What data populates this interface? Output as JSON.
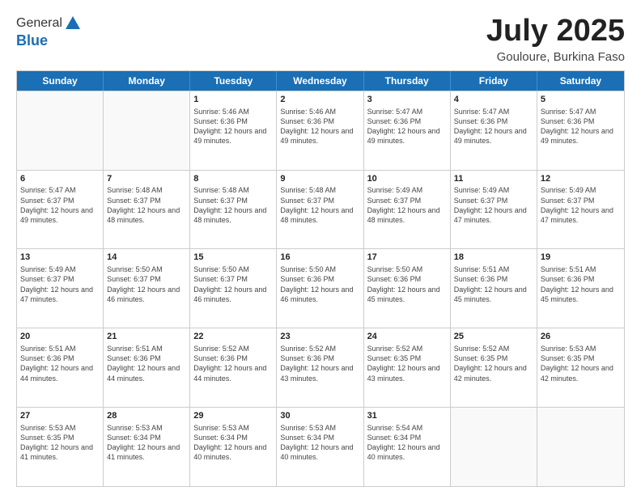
{
  "header": {
    "logo_line1": "General",
    "logo_line2": "Blue",
    "month": "July 2025",
    "location": "Gouloure, Burkina Faso"
  },
  "weekdays": [
    "Sunday",
    "Monday",
    "Tuesday",
    "Wednesday",
    "Thursday",
    "Friday",
    "Saturday"
  ],
  "weeks": [
    [
      {
        "day": "",
        "sunrise": "",
        "sunset": "",
        "daylight": ""
      },
      {
        "day": "",
        "sunrise": "",
        "sunset": "",
        "daylight": ""
      },
      {
        "day": "1",
        "sunrise": "Sunrise: 5:46 AM",
        "sunset": "Sunset: 6:36 PM",
        "daylight": "Daylight: 12 hours and 49 minutes."
      },
      {
        "day": "2",
        "sunrise": "Sunrise: 5:46 AM",
        "sunset": "Sunset: 6:36 PM",
        "daylight": "Daylight: 12 hours and 49 minutes."
      },
      {
        "day": "3",
        "sunrise": "Sunrise: 5:47 AM",
        "sunset": "Sunset: 6:36 PM",
        "daylight": "Daylight: 12 hours and 49 minutes."
      },
      {
        "day": "4",
        "sunrise": "Sunrise: 5:47 AM",
        "sunset": "Sunset: 6:36 PM",
        "daylight": "Daylight: 12 hours and 49 minutes."
      },
      {
        "day": "5",
        "sunrise": "Sunrise: 5:47 AM",
        "sunset": "Sunset: 6:36 PM",
        "daylight": "Daylight: 12 hours and 49 minutes."
      }
    ],
    [
      {
        "day": "6",
        "sunrise": "Sunrise: 5:47 AM",
        "sunset": "Sunset: 6:37 PM",
        "daylight": "Daylight: 12 hours and 49 minutes."
      },
      {
        "day": "7",
        "sunrise": "Sunrise: 5:48 AM",
        "sunset": "Sunset: 6:37 PM",
        "daylight": "Daylight: 12 hours and 48 minutes."
      },
      {
        "day": "8",
        "sunrise": "Sunrise: 5:48 AM",
        "sunset": "Sunset: 6:37 PM",
        "daylight": "Daylight: 12 hours and 48 minutes."
      },
      {
        "day": "9",
        "sunrise": "Sunrise: 5:48 AM",
        "sunset": "Sunset: 6:37 PM",
        "daylight": "Daylight: 12 hours and 48 minutes."
      },
      {
        "day": "10",
        "sunrise": "Sunrise: 5:49 AM",
        "sunset": "Sunset: 6:37 PM",
        "daylight": "Daylight: 12 hours and 48 minutes."
      },
      {
        "day": "11",
        "sunrise": "Sunrise: 5:49 AM",
        "sunset": "Sunset: 6:37 PM",
        "daylight": "Daylight: 12 hours and 47 minutes."
      },
      {
        "day": "12",
        "sunrise": "Sunrise: 5:49 AM",
        "sunset": "Sunset: 6:37 PM",
        "daylight": "Daylight: 12 hours and 47 minutes."
      }
    ],
    [
      {
        "day": "13",
        "sunrise": "Sunrise: 5:49 AM",
        "sunset": "Sunset: 6:37 PM",
        "daylight": "Daylight: 12 hours and 47 minutes."
      },
      {
        "day": "14",
        "sunrise": "Sunrise: 5:50 AM",
        "sunset": "Sunset: 6:37 PM",
        "daylight": "Daylight: 12 hours and 46 minutes."
      },
      {
        "day": "15",
        "sunrise": "Sunrise: 5:50 AM",
        "sunset": "Sunset: 6:37 PM",
        "daylight": "Daylight: 12 hours and 46 minutes."
      },
      {
        "day": "16",
        "sunrise": "Sunrise: 5:50 AM",
        "sunset": "Sunset: 6:36 PM",
        "daylight": "Daylight: 12 hours and 46 minutes."
      },
      {
        "day": "17",
        "sunrise": "Sunrise: 5:50 AM",
        "sunset": "Sunset: 6:36 PM",
        "daylight": "Daylight: 12 hours and 45 minutes."
      },
      {
        "day": "18",
        "sunrise": "Sunrise: 5:51 AM",
        "sunset": "Sunset: 6:36 PM",
        "daylight": "Daylight: 12 hours and 45 minutes."
      },
      {
        "day": "19",
        "sunrise": "Sunrise: 5:51 AM",
        "sunset": "Sunset: 6:36 PM",
        "daylight": "Daylight: 12 hours and 45 minutes."
      }
    ],
    [
      {
        "day": "20",
        "sunrise": "Sunrise: 5:51 AM",
        "sunset": "Sunset: 6:36 PM",
        "daylight": "Daylight: 12 hours and 44 minutes."
      },
      {
        "day": "21",
        "sunrise": "Sunrise: 5:51 AM",
        "sunset": "Sunset: 6:36 PM",
        "daylight": "Daylight: 12 hours and 44 minutes."
      },
      {
        "day": "22",
        "sunrise": "Sunrise: 5:52 AM",
        "sunset": "Sunset: 6:36 PM",
        "daylight": "Daylight: 12 hours and 44 minutes."
      },
      {
        "day": "23",
        "sunrise": "Sunrise: 5:52 AM",
        "sunset": "Sunset: 6:36 PM",
        "daylight": "Daylight: 12 hours and 43 minutes."
      },
      {
        "day": "24",
        "sunrise": "Sunrise: 5:52 AM",
        "sunset": "Sunset: 6:35 PM",
        "daylight": "Daylight: 12 hours and 43 minutes."
      },
      {
        "day": "25",
        "sunrise": "Sunrise: 5:52 AM",
        "sunset": "Sunset: 6:35 PM",
        "daylight": "Daylight: 12 hours and 42 minutes."
      },
      {
        "day": "26",
        "sunrise": "Sunrise: 5:53 AM",
        "sunset": "Sunset: 6:35 PM",
        "daylight": "Daylight: 12 hours and 42 minutes."
      }
    ],
    [
      {
        "day": "27",
        "sunrise": "Sunrise: 5:53 AM",
        "sunset": "Sunset: 6:35 PM",
        "daylight": "Daylight: 12 hours and 41 minutes."
      },
      {
        "day": "28",
        "sunrise": "Sunrise: 5:53 AM",
        "sunset": "Sunset: 6:34 PM",
        "daylight": "Daylight: 12 hours and 41 minutes."
      },
      {
        "day": "29",
        "sunrise": "Sunrise: 5:53 AM",
        "sunset": "Sunset: 6:34 PM",
        "daylight": "Daylight: 12 hours and 40 minutes."
      },
      {
        "day": "30",
        "sunrise": "Sunrise: 5:53 AM",
        "sunset": "Sunset: 6:34 PM",
        "daylight": "Daylight: 12 hours and 40 minutes."
      },
      {
        "day": "31",
        "sunrise": "Sunrise: 5:54 AM",
        "sunset": "Sunset: 6:34 PM",
        "daylight": "Daylight: 12 hours and 40 minutes."
      },
      {
        "day": "",
        "sunrise": "",
        "sunset": "",
        "daylight": ""
      },
      {
        "day": "",
        "sunrise": "",
        "sunset": "",
        "daylight": ""
      }
    ]
  ]
}
